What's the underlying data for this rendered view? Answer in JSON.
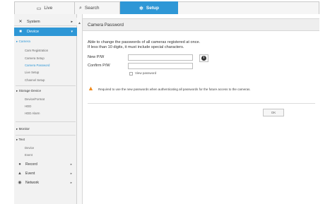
{
  "tabs": {
    "live": "Live",
    "search": "Search",
    "setup": "Setup"
  },
  "sidebar": {
    "system": "System",
    "device": "Device",
    "groups": {
      "camera": "Camera",
      "storage": "Storage Device",
      "monitor": "Monitor",
      "text": "Text"
    },
    "camera_items": [
      "Cam Registration",
      "Camera Setup",
      "Camera Password",
      "Live Setup",
      "Channel Setup"
    ],
    "storage_items": [
      "Device/Format",
      "HDD",
      "HDD Alarm"
    ],
    "text_items": [
      "Device",
      "Event"
    ],
    "footer": [
      "Record",
      "Event",
      "Network"
    ]
  },
  "content": {
    "title": "Camera Password",
    "desc_line1": "Able to change the passwords of all cameras registered at once.",
    "desc_line2": "If less than 10 digits, it must include special characters.",
    "new_pw_label": "New P/W",
    "confirm_pw_label": "Confirm P/W",
    "view_password": "View password",
    "warning": "Required to use the new passwords when authenticating all passwords for the future access to the cameras.",
    "ok": "OK"
  },
  "colors": {
    "accent": "#2e97d6",
    "warning": "#f08a1c"
  },
  "icons": {
    "live": "monitor-icon",
    "setup": "gear-icon",
    "system": "tools-icon",
    "device": "camera-icon",
    "info": "info-icon",
    "warning": "warning-icon"
  }
}
